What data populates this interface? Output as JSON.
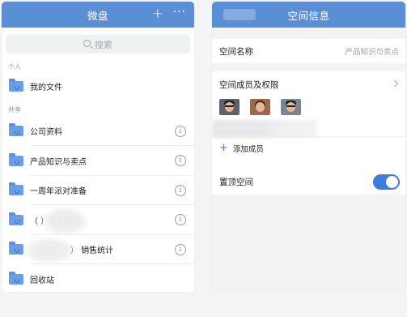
{
  "left_panel": {
    "title": "微盘",
    "plus": "+",
    "more": "···",
    "search_placeholder": "搜索",
    "section_personal": "个人",
    "personal_items": [
      {
        "label": "我的文件"
      }
    ],
    "section_shared": "共享",
    "shared_items": [
      {
        "label": "公司资料"
      },
      {
        "label": "产品知识与卖点"
      },
      {
        "label": "一周年派对准备"
      },
      {
        "label": "（ ）销售统计"
      },
      {
        "label": "） 销售统计"
      },
      {
        "label": "回收站"
      }
    ],
    "info_glyph": "i"
  },
  "right_panel": {
    "title": "空间信息",
    "space_name_label": "空间名称",
    "space_name_value": "产品知识与卖点",
    "members_label": "空间成员及权限",
    "add_member_label": "添加成员",
    "pin_label": "置顶空间",
    "pin_enabled": true
  },
  "colors": {
    "header_blue": "#5a8fd6",
    "toggle_blue": "#3f7be0",
    "folder_blue": "#6c9ee6"
  }
}
